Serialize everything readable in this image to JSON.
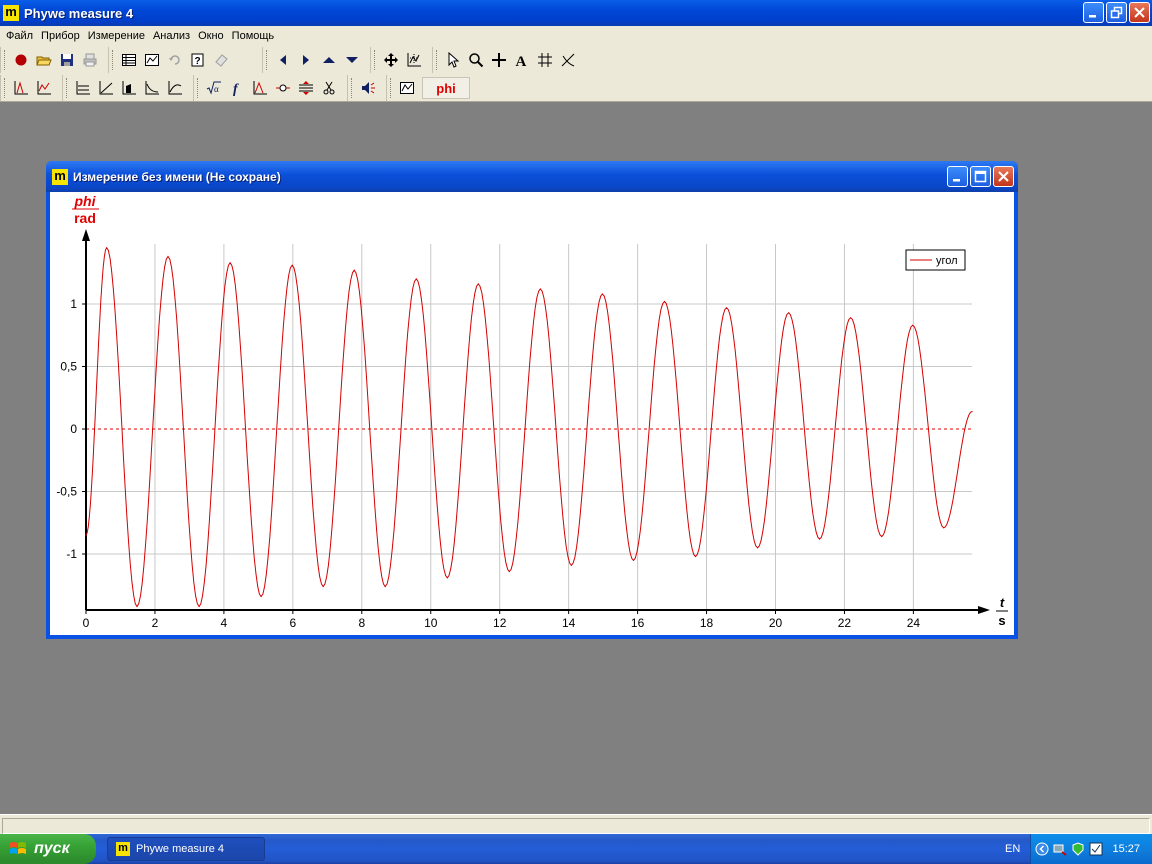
{
  "app": {
    "title": "Phywe measure 4",
    "logo_letter": "m"
  },
  "menubar": {
    "items": [
      "Файл",
      "Прибор",
      "Измерение",
      "Анализ",
      "Окно",
      "Помощь"
    ]
  },
  "toolbar": {
    "phi_label": "phi"
  },
  "child_window": {
    "title": "Измерение без имени (Не сохране)"
  },
  "chart_data": {
    "type": "line",
    "title": "",
    "ylabel_symbol": "phi",
    "ylabel_unit": "rad",
    "xlabel_symbol": "t",
    "xlabel_unit": "s",
    "xlim": [
      0,
      25.7
    ],
    "ylim": [
      -1.43,
      1.43
    ],
    "xticks": [
      0,
      2,
      4,
      6,
      8,
      10,
      12,
      14,
      16,
      18,
      20,
      22,
      24
    ],
    "xtick_labels": [
      "0",
      "2",
      "4",
      "6",
      "8",
      "10",
      "12",
      "14",
      "16",
      "18",
      "20",
      "22",
      "24"
    ],
    "yticks": [
      -1,
      -0.5,
      0,
      0.5,
      1
    ],
    "ytick_labels": [
      "-1",
      "-0,5",
      "0",
      "0,5",
      "1"
    ],
    "grid": true,
    "legend": {
      "position": "top-right"
    },
    "zero_line": {
      "y": 0,
      "style": "dashed",
      "color": "#e00000"
    },
    "series": [
      {
        "name": "угол",
        "color": "#d40000",
        "x": [
          0.0,
          0.6,
          1.48,
          2.38,
          3.28,
          4.18,
          5.08,
          5.98,
          6.88,
          7.78,
          8.68,
          9.58,
          10.48,
          11.38,
          12.28,
          13.18,
          14.08,
          14.98,
          15.88,
          16.78,
          17.68,
          18.58,
          19.48,
          20.38,
          21.28,
          22.18,
          23.08,
          23.98,
          24.88,
          25.7
        ],
        "y": [
          -0.85,
          1.45,
          -1.42,
          1.38,
          -1.42,
          1.33,
          -1.34,
          1.31,
          -1.26,
          1.27,
          -1.26,
          1.2,
          -1.19,
          1.16,
          -1.14,
          1.12,
          -1.09,
          1.08,
          -1.05,
          1.02,
          -1.02,
          0.97,
          -0.95,
          0.93,
          -0.88,
          0.89,
          -0.86,
          0.83,
          -0.79,
          0.14
        ]
      }
    ]
  },
  "taskbar": {
    "start_label": "пуск",
    "task_label": "Phywe measure 4",
    "lang": "EN",
    "clock": "15:27"
  }
}
